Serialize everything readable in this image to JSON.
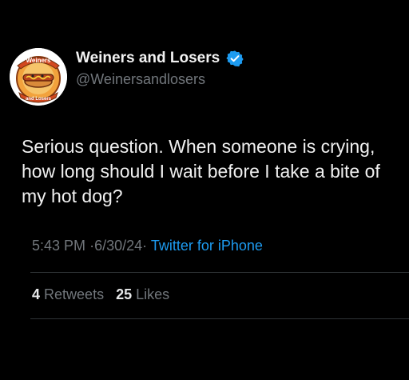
{
  "author": {
    "display_name": "Weiners and Losers",
    "handle": "@Weinersandlosers",
    "avatar_text_top": "Weiners",
    "avatar_text_bottom": "and Losers"
  },
  "tweet": {
    "text": "Serious question. When someone is crying, how long should I wait before I take a bite of my hot dog?"
  },
  "meta": {
    "time": "5:43 PM",
    "date": "6/30/24",
    "separator": "·",
    "source": "Twitter for iPhone"
  },
  "stats": {
    "retweets_count": "4",
    "retweets_label": "Retweets",
    "likes_count": "25",
    "likes_label": "Likes"
  },
  "colors": {
    "background": "#000000",
    "link": "#1d9bf0",
    "secondary_text": "#71767b",
    "verified": "#1d9bf0"
  },
  "icons": {
    "verified": "verified-badge-icon",
    "avatar": "hotdog-logo"
  }
}
